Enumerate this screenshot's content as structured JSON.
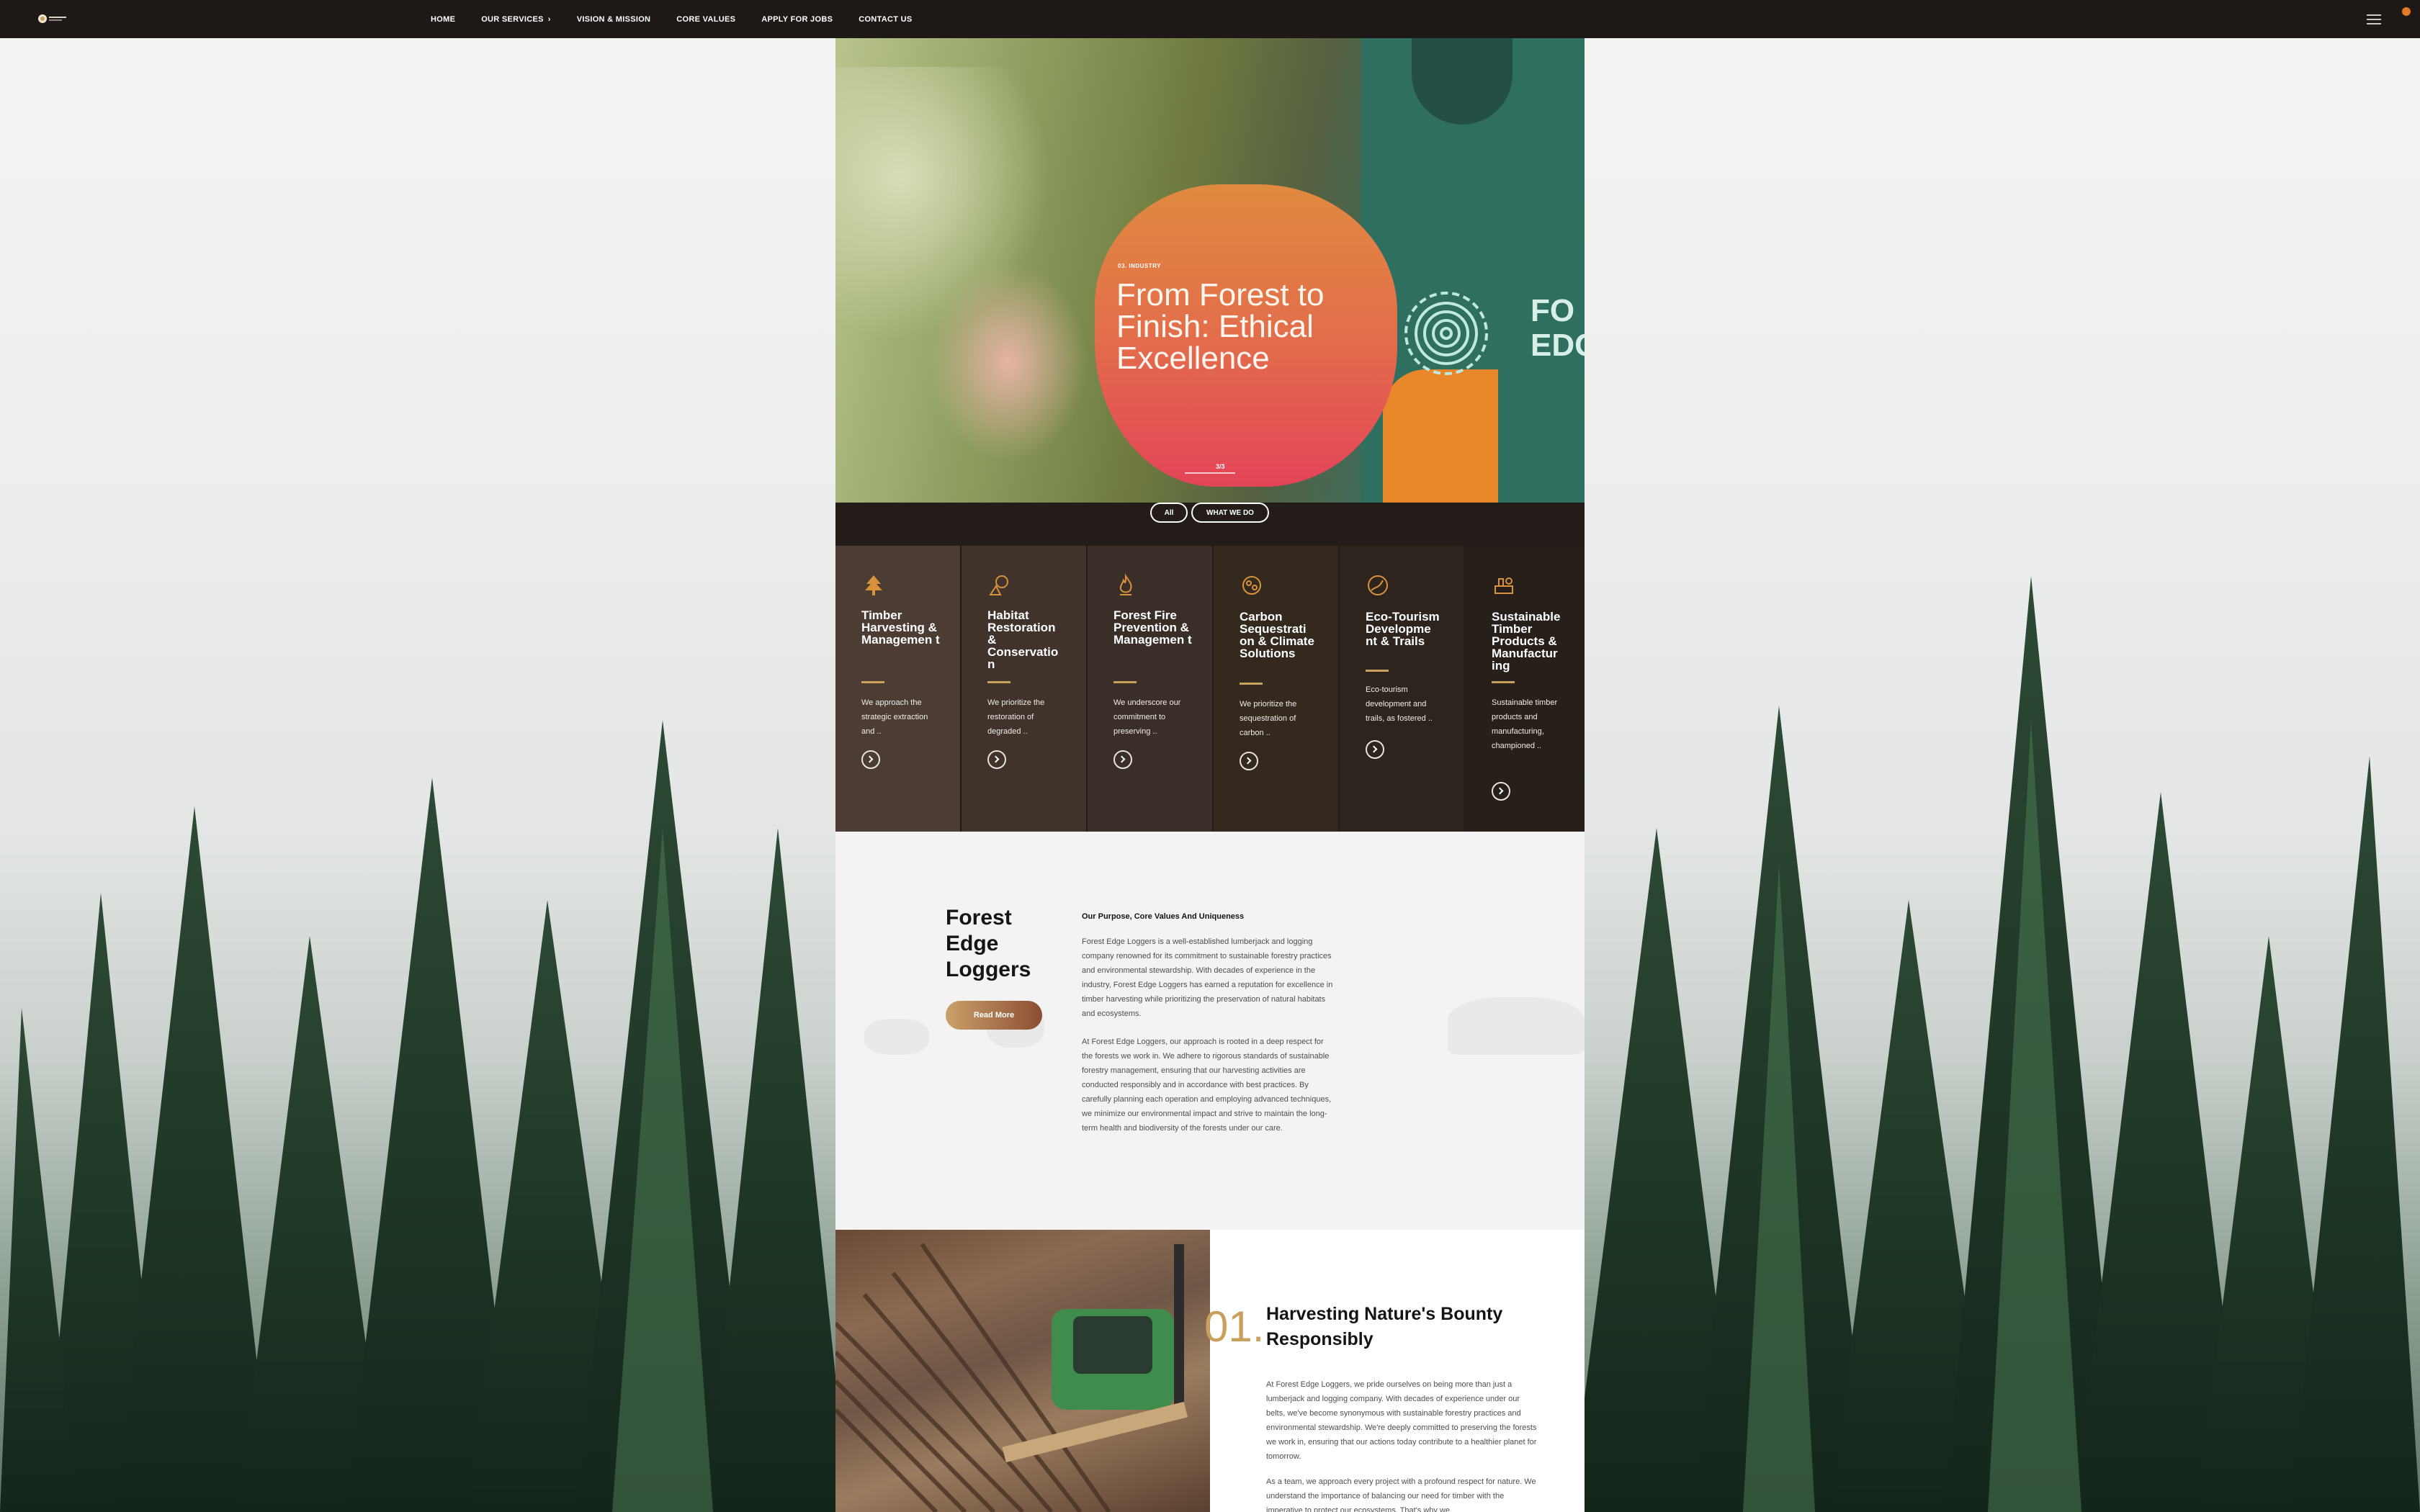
{
  "nav": {
    "items": [
      "HOME",
      "OUR SERVICES",
      "VISION & MISSION",
      "CORE VALUES",
      "APPLY FOR JOBS",
      "CONTACT US"
    ]
  },
  "hero": {
    "tag": "03. INDUSTRY",
    "title": "From Forest to Finish: Ethical Excellence",
    "counter": "3/3",
    "shirt_text_1": "FO",
    "shirt_text_2": "EDG"
  },
  "filters": {
    "all": "All",
    "what_we_do": "WHAT WE DO"
  },
  "services": [
    {
      "title": "Timber Harvesting & Managemen t",
      "text": "We approach the strategic extraction and ..",
      "icon": "tree-icon"
    },
    {
      "title": "Habitat Restoration & Conservatio n",
      "text": "We prioritize the restoration of degraded ..",
      "icon": "habitat-icon"
    },
    {
      "title": "Forest Fire Prevention & Managemen t",
      "text": "We underscore our commitment to preserving ..",
      "icon": "flame-icon"
    },
    {
      "title": "Carbon Sequestrati on & Climate Solutions",
      "text": "We prioritize the sequestration of carbon ..",
      "icon": "carbon-icon"
    },
    {
      "title": "Eco-Tourism Developme nt & Trails",
      "text": "Eco-tourism development and trails, as fostered ..",
      "icon": "trail-icon"
    },
    {
      "title": "Sustainable Timber Products & Manufactur ing",
      "text": "Sustainable timber products and manufacturing, championed ..",
      "icon": "sawmill-icon"
    }
  ],
  "about": {
    "title": "Forest Edge Loggers",
    "button": "Read More",
    "subtitle": "Our Purpose, Core Values And Uniqueness",
    "p1": "Forest Edge Loggers is a well-established lumberjack and logging company renowned for its commitment to sustainable forestry practices and environmental stewardship. With decades of experience in the industry, Forest Edge Loggers has earned a reputation for excellence in timber harvesting while prioritizing the preservation of natural habitats and ecosystems.",
    "p2": "At Forest Edge Loggers, our approach is rooted in a deep respect for the forests we work in. We adhere to rigorous standards of sustainable forestry management, ensuring that our harvesting activities are conducted responsibly and in accordance with best practices. By carefully planning each operation and employing advanced techniques, we minimize our environmental impact and strive to maintain the long-term health and biodiversity of the forests under our care."
  },
  "harvest": {
    "number": "01.",
    "title": "Harvesting Nature's Bounty Responsibly",
    "p1": "At Forest Edge Loggers, we pride ourselves on being more than just a lumberjack and logging company. With decades of experience under our belts, we've become synonymous with sustainable forestry practices and environmental stewardship. We're deeply committed to preserving the forests we work in, ensuring that our actions today contribute to a healthier planet for tomorrow.",
    "p2": "As a team, we approach every project with a profound respect for nature. We understand the importance of balancing our need for timber with the imperative to protect our ecosystems. That's why we"
  },
  "colors": {
    "nav_bg": "#1e1917",
    "services_bg": "#231c18",
    "accent_gold": "#c9a05c",
    "blob_top": "#e08a3f",
    "blob_bottom": "#e34458"
  }
}
